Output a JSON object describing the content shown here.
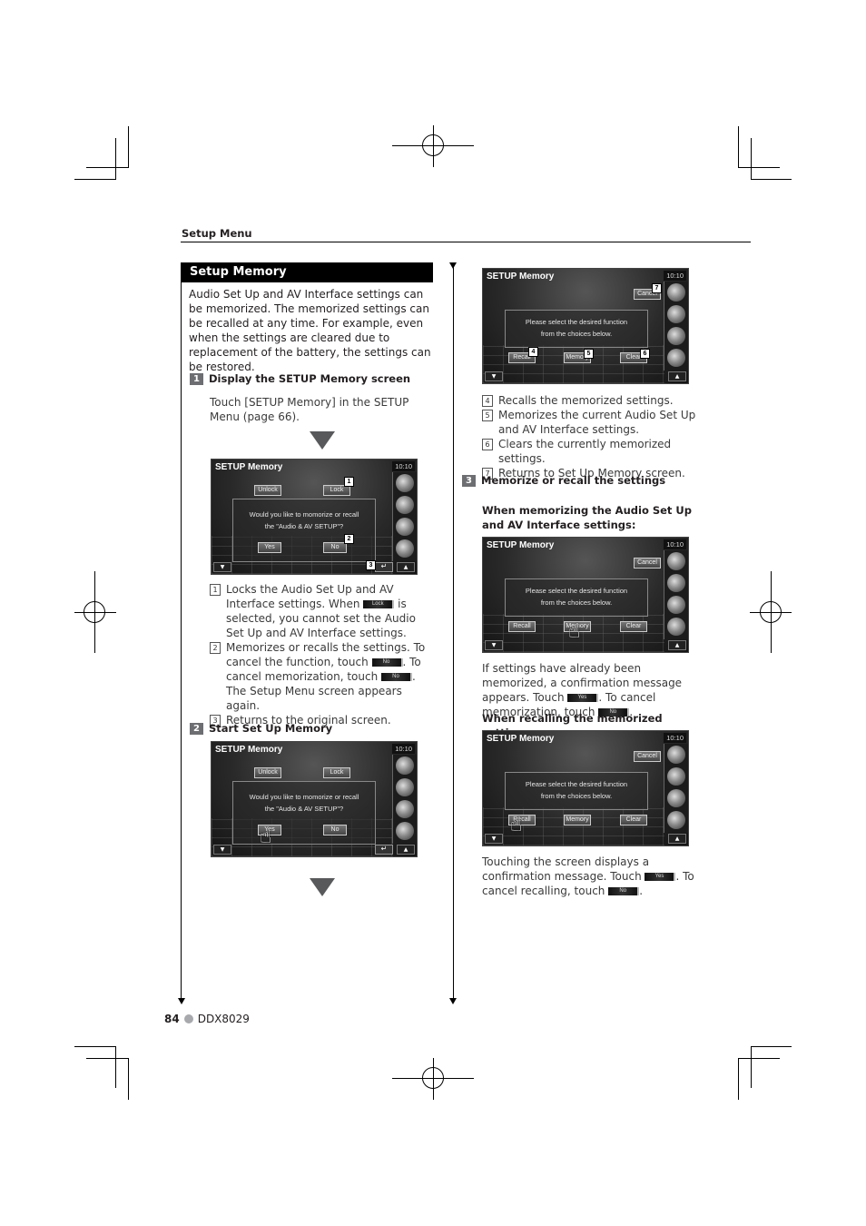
{
  "header": {
    "section": "Setup Menu"
  },
  "title": "Setup Memory",
  "intro": "Audio Set Up and AV Interface settings can be memorized. The memorized settings can be recalled at any time. For example, even when the settings are cleared due to replacement of the battery, the settings can be restored.",
  "steps": [
    {
      "number": "1",
      "title": "Display the SETUP Memory screen",
      "text": "Touch [SETUP Memory] in the SETUP Menu (page 66)."
    },
    {
      "number": "2",
      "title": "Start Set Up Memory"
    },
    {
      "number": "3",
      "title": "Memorize or recall the settings"
    }
  ],
  "screen_confirm": {
    "title": "SETUP Memory",
    "clock": "10:10",
    "unlock": "Unlock",
    "lock": "Lock",
    "message_line1": "Would you like to momorize or recall",
    "message_line2": "the \"Audio & AV SETUP\"?",
    "yes": "Yes",
    "no": "No",
    "footer_left": "▼",
    "footer_right": "▲",
    "return": "↵"
  },
  "screen_select": {
    "title": "SETUP Memory",
    "clock": "10:10",
    "cancel": "Cancel",
    "message_line1": "Please select the desired function",
    "message_line2": "from the choices below.",
    "recall": "Recall",
    "memory": "Memory",
    "clear": "Clear",
    "footer_left": "▼",
    "footer_right": "▲"
  },
  "callouts": {
    "c1": "1",
    "c2": "2",
    "c3": "3",
    "c4": "4",
    "c5": "5",
    "c6": "6",
    "c7": "7"
  },
  "list1": [
    {
      "num": "1",
      "before": "Locks the Audio Set Up and AV Interface settings. When ",
      "btn": "Lock",
      "after": " is selected, you cannot set the Audio Set Up and AV Interface settings."
    },
    {
      "num": "2",
      "before": "Memorizes or recalls the settings. To cancel the function, touch ",
      "btn": "No",
      "mid": ". To cancel memorization, touch ",
      "btn2": "No",
      "after": ".",
      "extra": "The Setup Menu screen appears again."
    },
    {
      "num": "3",
      "before": "Returns to the original screen."
    }
  ],
  "list2": [
    {
      "num": "4",
      "text": "Recalls the memorized settings."
    },
    {
      "num": "5",
      "text": "Memorizes the current Audio Set Up and AV Interface settings."
    },
    {
      "num": "6",
      "text": "Clears the currently memorized settings."
    },
    {
      "num": "7",
      "text": "Returns to Set Up Memory screen."
    }
  ],
  "memorizing": {
    "title": "When memorizing the Audio Set Up and AV Interface settings:",
    "text_a": "If settings have already been memorized, a confirmation message appears. Touch ",
    "btn_yes": "Yes",
    "text_b": ". To cancel memorization, touch ",
    "btn_no": "No",
    "text_c": "."
  },
  "recalling": {
    "title": "When recalling the memorized settings:",
    "text_a": "Touching the screen displays a confirmation message. Touch ",
    "btn_yes": "Yes",
    "text_b": ". To cancel recalling, touch ",
    "btn_no": "No",
    "text_c": "."
  },
  "footer": {
    "page": "84",
    "model": "DDX8029"
  }
}
